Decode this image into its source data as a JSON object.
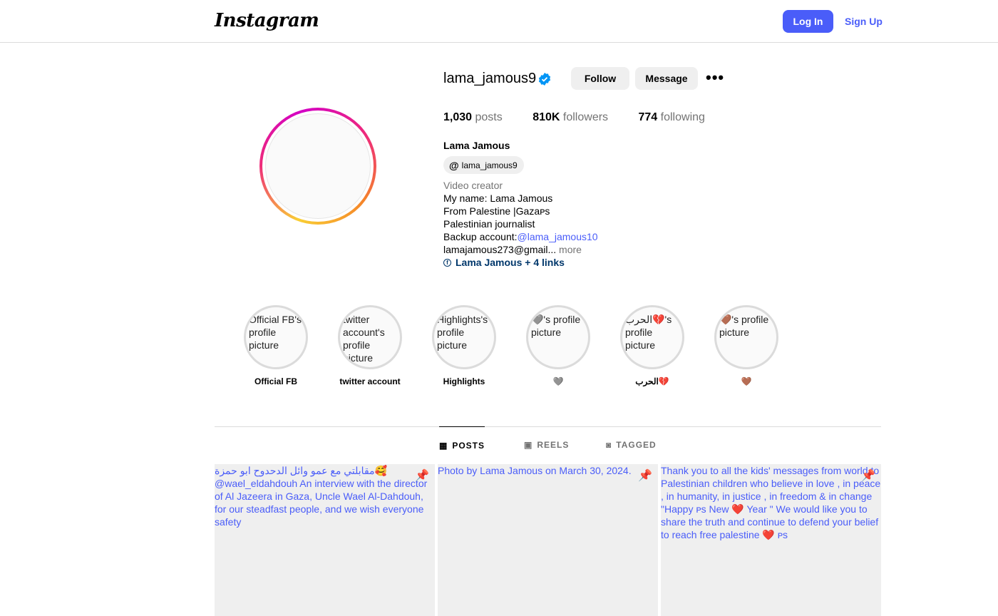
{
  "header": {
    "logo": "Instagram",
    "login": "Log In",
    "signup": "Sign Up"
  },
  "profile": {
    "username": "lama_jamous9",
    "follow": "Follow",
    "message": "Message",
    "stats": {
      "posts_count": "1,030",
      "posts_label": "posts",
      "followers_count": "810K",
      "followers_label": "followers",
      "following_count": "774",
      "following_label": "following"
    },
    "full_name": "Lama Jamous",
    "threads_handle": "lama_jamous9",
    "category": "Video creator",
    "bio": [
      "My name: Lama Jamous",
      "From Palestine |Gazaᴘs",
      "Palestinian journalist"
    ],
    "backup_label": "Backup account:",
    "backup_link": "@lama_jamous10",
    "email": "lamajamous273@gmail...",
    "more": " more",
    "links": "Lama Jamous + 4 links"
  },
  "highlights": [
    {
      "alt": "Official FB's profile picture",
      "label": "Official FB"
    },
    {
      "alt": "twitter account's profile picture",
      "label": "twitter account"
    },
    {
      "alt": "Highlights's profile picture",
      "label": "Highlights"
    },
    {
      "alt": "🩶's profile picture",
      "label": "🩶"
    },
    {
      "alt": "الحرب💔's profile picture",
      "label": "الحرب💔"
    },
    {
      "alt": "🤎's profile picture",
      "label": "🤎"
    }
  ],
  "tabs": {
    "posts": "POSTS",
    "reels": "REELS",
    "tagged": "TAGGED"
  },
  "posts": [
    {
      "alt": "مقابلتي مع عمو وائل الدحدوح ابو حمزة🥰 @wael_eldahdouh An interview with the director of Al Jazeera in Gaza, Uncle Wael Al-Dahdouh, for our steadfast people, and we wish everyone safety"
    },
    {
      "alt": "Photo by Lama Jamous on March 30, 2024."
    },
    {
      "alt": "Thank you to all the kids' messages from world to Palestinian children who believe in love , in peace , in humanity, in justice , in freedom & in change \"Happy ᴘs New ❤️ Year \" We would like you to share the truth and continue to defend your belief to reach free palestine ❤️ ᴘs"
    }
  ],
  "colors": {
    "accent": "#4a5df9",
    "verified": "#0095f6"
  }
}
